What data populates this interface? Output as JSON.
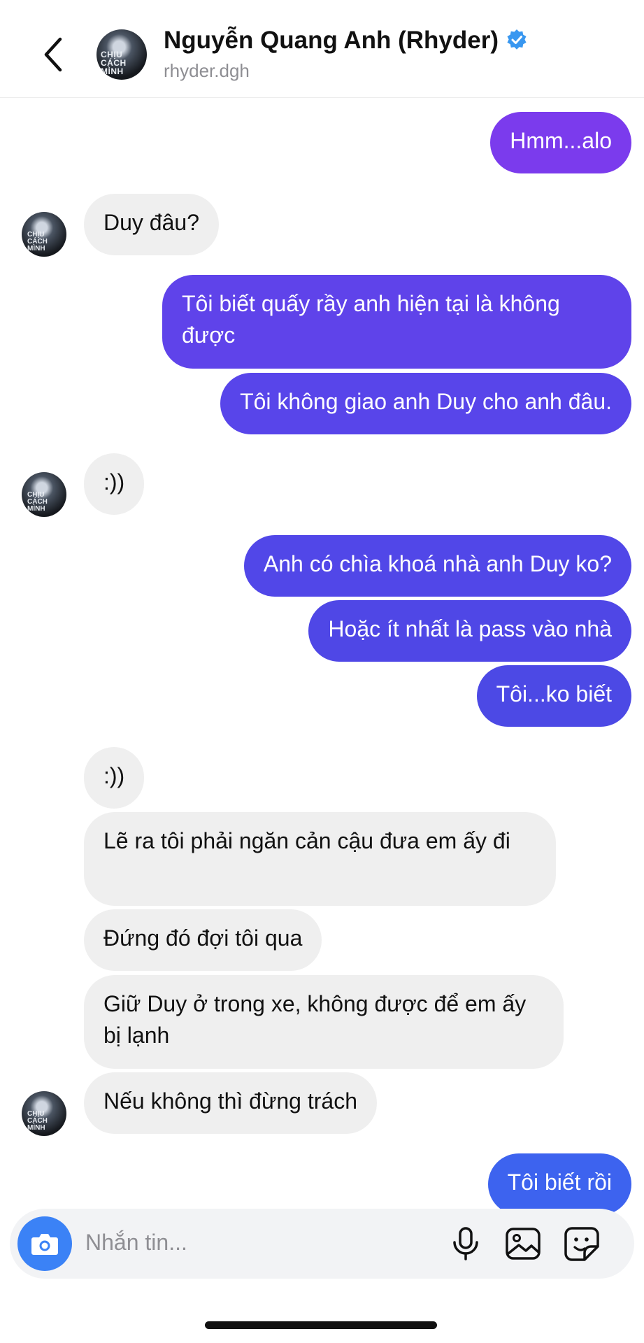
{
  "header": {
    "name": "Nguyễn Quang Anh (Rhyder)",
    "username": "rhyder.dgh",
    "avatar_text_1": "CHỊU CÁCH",
    "avatar_text_2": "MÌNH"
  },
  "messages": [
    {
      "side": "sent",
      "text": "Hmm...alo"
    },
    {
      "side": "recv",
      "text": "Duy đâu?"
    },
    {
      "side": "sent",
      "text": "Tôi biết quấy rầy anh hiện tại là không được"
    },
    {
      "side": "sent",
      "text": "Tôi không giao anh Duy cho anh đâu."
    },
    {
      "side": "recv",
      "text": ":))"
    },
    {
      "side": "sent",
      "text": "Anh có chìa khoá nhà anh Duy ko?"
    },
    {
      "side": "sent",
      "text": "Hoặc ít nhất là pass vào nhà"
    },
    {
      "side": "sent",
      "text": "Tôi...ko biết"
    },
    {
      "side": "recv",
      "text": ":))"
    },
    {
      "side": "recv",
      "text": "Lẽ ra tôi phải ngăn cản cậu đưa em ấy đi"
    },
    {
      "side": "recv",
      "text": "Đứng đó đợi tôi qua"
    },
    {
      "side": "recv",
      "text": "Giữ Duy ở trong xe, không được để em ấy bị lạnh"
    },
    {
      "side": "recv",
      "text": "Nếu không thì đừng trách"
    },
    {
      "side": "sent",
      "text": "Tôi biết rồi"
    }
  ],
  "composer": {
    "placeholder": "Nhắn tin..."
  },
  "icons": {
    "back": "chevron-left-icon",
    "verified": "verified-badge-icon",
    "camera": "camera-icon",
    "mic": "microphone-icon",
    "gallery": "image-icon",
    "sticker": "sticker-icon"
  },
  "colors": {
    "sent_top": "#7c3aed",
    "sent_bottom": "#4f46e5",
    "received": "#efefef",
    "accent_blue": "#3b82f6"
  }
}
